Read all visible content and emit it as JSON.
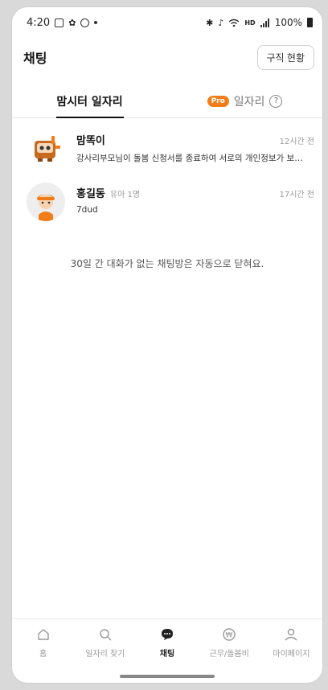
{
  "status_bar": {
    "time": "4:20",
    "right_text": "100%",
    "icons": [
      "gallery-icon",
      "leaf-icon",
      "circle-icon",
      "dot-icon",
      "bluetooth-icon",
      "mute-icon",
      "wifi-icon",
      "hd-icon",
      "signal-icon",
      "battery-icon"
    ]
  },
  "header": {
    "title": "채팅",
    "job_status_button": "구직 현황"
  },
  "tabs": [
    {
      "label": "맘시터 일자리",
      "active": true
    },
    {
      "label": "일자리",
      "badge": "Pro",
      "active": false
    }
  ],
  "chats": [
    {
      "name": "맘똑이",
      "sub": "",
      "time": "12시간 전",
      "message": "강사리부모님이 돌봄 신청서를 종료하여 서로의 개인정보가 보이지 않아요"
    },
    {
      "name": "홍길동",
      "sub": "유아 1명",
      "time": "17시간 전",
      "message": "7dud"
    }
  ],
  "notice": "30일 간 대화가 없는 채팅방은 자동으로 닫혀요.",
  "bottom_nav": [
    {
      "label": "홈",
      "icon": "home-icon",
      "active": false
    },
    {
      "label": "일자리 찾기",
      "icon": "search-icon",
      "active": false
    },
    {
      "label": "채팅",
      "icon": "chat-icon",
      "active": true
    },
    {
      "label": "근무/돌봄비",
      "icon": "won-icon",
      "active": false
    },
    {
      "label": "마이페이지",
      "icon": "person-icon",
      "active": false
    }
  ],
  "colors": {
    "accent": "#f07d1a",
    "text": "#222222",
    "muted": "#999999"
  }
}
